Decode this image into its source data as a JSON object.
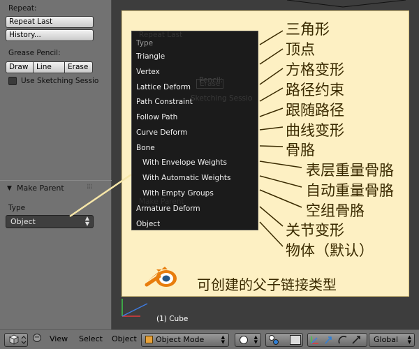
{
  "shelf": {
    "repeat_label": "Repeat:",
    "repeat_last": "Repeat Last",
    "history": "History...",
    "grease_label": "Grease Pencil:",
    "grease_buttons": [
      "Draw",
      "Line",
      "Erase"
    ],
    "sketching": "Use Sketching Sessio",
    "make_parent": "Make Parent",
    "type_label": "Type",
    "type_value": "Object"
  },
  "menu": {
    "header": "Type",
    "items": [
      "Triangle",
      "Vertex",
      "Lattice Deform",
      "Path Constraint",
      "Follow Path",
      "Curve Deform",
      "Bone",
      "With Envelope Weights",
      "With Automatic Weights",
      "With Empty Groups",
      "Armature Deform",
      "Object"
    ],
    "ghost": {
      "repeat_last": "Repeat Last",
      "pencil": "Pencil:",
      "erase": "Erase",
      "sketching": "Sketching Sessio",
      "make_parent": "Make Parent"
    }
  },
  "annotations": {
    "items": [
      "三角形",
      "顶点",
      "方格变形",
      "路径约束",
      "跟随路径",
      "曲线变形",
      "骨胳",
      "表层重量骨胳",
      "自动重量骨胳",
      "空组骨胳",
      "关节变形",
      "物体（默认）"
    ],
    "bottom_note": "可创建的父子链接类型"
  },
  "viewport": {
    "object_label": "(1) Cube"
  },
  "header": {
    "menus": [
      "View",
      "Select",
      "Object"
    ],
    "mode": "Object Mode",
    "orientation": "Global"
  },
  "colors": {
    "callout_bg": "#fdf0c3",
    "menu_bg": "#1b1b1b",
    "annotation_text": "#3a2a00",
    "shelf_bg": "#727272",
    "viewport_bg": "#3d3d3d"
  }
}
